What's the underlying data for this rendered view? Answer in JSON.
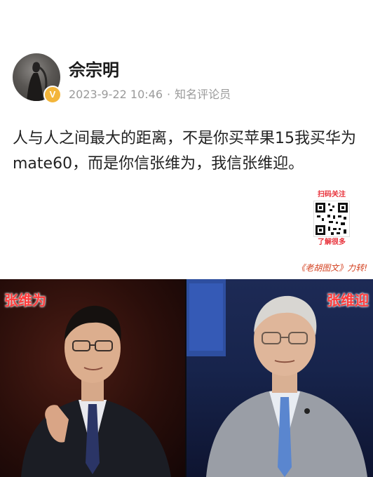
{
  "post": {
    "author": "佘宗明",
    "verified_badge": "V",
    "date": "2023-9-22 10:46",
    "separator": "·",
    "author_title": "知名评论员",
    "content": "人与人之间最大的距离，不是你买苹果15我买华为mate60，而是你信张维为，我信张维迎。",
    "qr_top_label": "扫码关注",
    "qr_bottom_label": "了解很多",
    "watermark": "《老胡图文》力转!"
  },
  "photos": {
    "left_name": "张维为",
    "right_name": "张维迎"
  },
  "colors": {
    "name_tag": "#ff3b3b",
    "badge": "#f3b53a",
    "meta_text": "#9a9a9a"
  },
  "icons": [
    "verified-badge-icon",
    "qr-code-icon"
  ]
}
